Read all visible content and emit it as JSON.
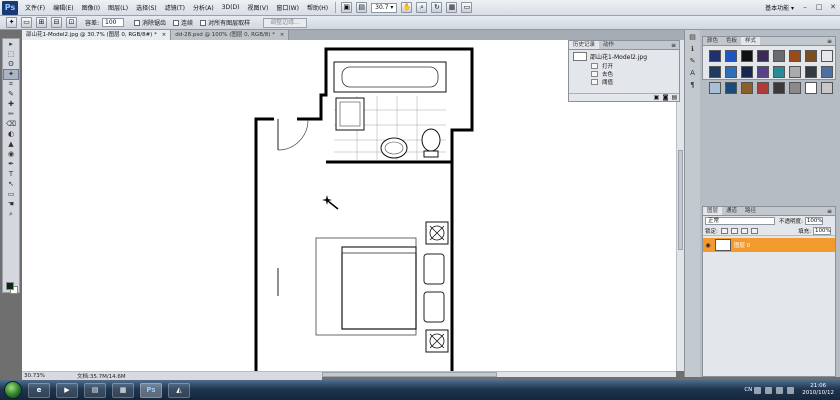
{
  "app": {
    "logo": "Ps",
    "workspace_label": "基本功能 ▾"
  },
  "menu": [
    "文件(F)",
    "编辑(E)",
    "图像(I)",
    "图层(L)",
    "选择(S)",
    "滤镜(T)",
    "分析(A)",
    "3D(D)",
    "视图(V)",
    "窗口(W)",
    "帮助(H)"
  ],
  "menubar": {
    "zoom_value": "30.7 ▾"
  },
  "window_buttons": [
    "–",
    "□",
    "✕"
  ],
  "options": {
    "tolerance_label": "容差:",
    "tolerance_value": "100",
    "antialias_label": "消除锯齿",
    "contiguous_label": "连续",
    "sample_all_label": "对所有图层取样",
    "refine_edge_label": "调整边缘..."
  },
  "tools": [
    "▸",
    "⬚",
    "ʘ",
    "✦",
    "⌗",
    "✎",
    "✚",
    "✏",
    "⌫",
    "◐",
    "▲",
    "◉",
    "✒",
    "T",
    "↖",
    "▭",
    "☚",
    "⌕"
  ],
  "doc_tabs": [
    {
      "label": "邵山花1-Model2.jpg @ 30.7% (图层 0, RGB/8#) *",
      "close": "×"
    },
    {
      "label": "dd-28.psd @ 100% (图层 0, RGB/8) *",
      "close": "×"
    }
  ],
  "status": {
    "zoom": "30.73%",
    "doc": "文档:35.7M/14.6M"
  },
  "history": {
    "tabs": [
      "历史记录",
      "动作"
    ],
    "snapshot": "邵山花1-Model2.jpg",
    "items": [
      "打开",
      "去色",
      "阈值"
    ]
  },
  "styles": {
    "tabs": [
      "颜色",
      "色板",
      "样式"
    ],
    "swatches": [
      "#20306e",
      "#1e57c2",
      "#111111",
      "#3a2a55",
      "#6a6a72",
      "#9a4b1c",
      "#7a4e20",
      "#e6e7ea",
      "#223a5e",
      "#2d6fb8",
      "#1b2650",
      "#5a3f8a",
      "#2a8a97",
      "#ababab",
      "#343a44",
      "#4e6fa0",
      "#a9bfd8",
      "#1a4c7a",
      "#8c5f2a",
      "#b33a3a",
      "#3a3a3a",
      "#8a8a8a",
      "#ffffff",
      "#c8c8c8"
    ]
  },
  "layers": {
    "tabs": [
      "图层",
      "通道",
      "路径"
    ],
    "mode": "正常",
    "opacity_label": "不透明度:",
    "opacity_value": "100%",
    "lock_label": "锁定:",
    "fill_label": "填充:",
    "fill_value": "100%",
    "items": [
      {
        "name": "图层 0"
      }
    ]
  },
  "taskbar": {
    "apps": [
      "",
      "",
      "",
      "",
      "Ps",
      "◭"
    ],
    "tray_lang": "CN",
    "time": "21:06",
    "date": "2010/10/12"
  }
}
